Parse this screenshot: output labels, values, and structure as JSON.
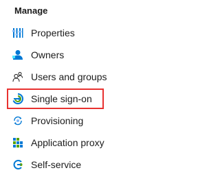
{
  "section": {
    "title": "Manage"
  },
  "items": [
    {
      "label": "Properties",
      "icon": "properties-icon"
    },
    {
      "label": "Owners",
      "icon": "owners-icon"
    },
    {
      "label": "Users and groups",
      "icon": "users-groups-icon"
    },
    {
      "label": "Single sign-on",
      "icon": "single-sign-on-icon",
      "highlighted": true
    },
    {
      "label": "Provisioning",
      "icon": "provisioning-icon"
    },
    {
      "label": "Application proxy",
      "icon": "application-proxy-icon"
    },
    {
      "label": "Self-service",
      "icon": "self-service-icon"
    }
  ],
  "colors": {
    "highlight_border": "#e8312f",
    "accent_blue": "#0078d4",
    "accent_green": "#57a300"
  }
}
